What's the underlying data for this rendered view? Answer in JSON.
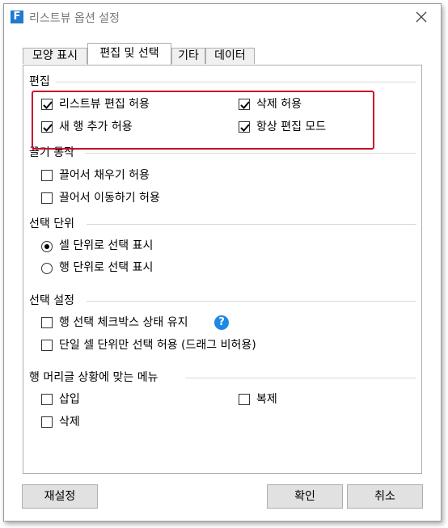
{
  "window": {
    "title": "리스트뷰 옵션 설정",
    "app_icon": "F"
  },
  "tabs": [
    {
      "label": "모양 표시",
      "active": false
    },
    {
      "label": "편집 및 선택",
      "active": true
    },
    {
      "label": "기타",
      "active": false
    },
    {
      "label": "데이터",
      "active": false
    }
  ],
  "groups": {
    "edit": {
      "title": "편집",
      "items": [
        {
          "label": "리스트뷰 편집 허용",
          "checked": true
        },
        {
          "label": "삭제 허용",
          "checked": true
        },
        {
          "label": "새 행 추가 허용",
          "checked": true
        },
        {
          "label": "항상 편집 모드",
          "checked": true
        }
      ]
    },
    "drag": {
      "title": "끌기 동작",
      "items": [
        {
          "label": "끌어서 채우기 허용",
          "checked": false
        },
        {
          "label": "끌어서 이동하기 허용",
          "checked": false
        }
      ]
    },
    "unit": {
      "title": "선택 단위",
      "items": [
        {
          "label": "셀 단위로 선택 표시",
          "selected": true
        },
        {
          "label": "행 단위로 선택 표시",
          "selected": false
        }
      ]
    },
    "selection": {
      "title": "선택 설정",
      "items": [
        {
          "label": "행 선택 체크박스 상태 유지",
          "checked": false
        },
        {
          "label": "단일 셀 단위만 선택 허용 (드래그 비허용)",
          "checked": false
        }
      ],
      "help_icon": "?"
    },
    "row_header": {
      "title": "행 머리글 상황에 맞는 메뉴",
      "items": [
        {
          "label": "삽입",
          "checked": false
        },
        {
          "label": "복제",
          "checked": false
        },
        {
          "label": "삭제",
          "checked": false
        }
      ]
    }
  },
  "buttons": {
    "reset": "재설정",
    "ok": "확인",
    "cancel": "취소"
  },
  "colors": {
    "highlight": "#c8102e",
    "help": "#1e88e5",
    "app_icon": "#1f7ad0"
  }
}
